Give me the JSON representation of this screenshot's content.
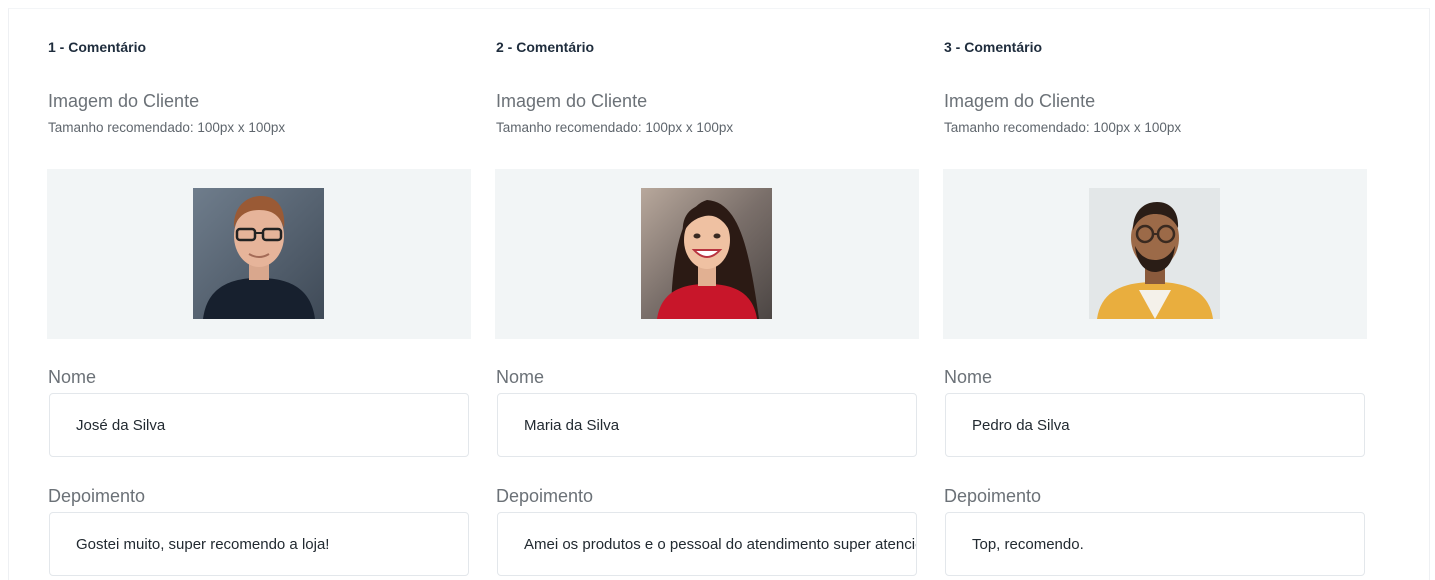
{
  "comments": [
    {
      "title": "1 - Comentário",
      "image_label": "Imagem do Cliente",
      "image_hint": "Tamanho recomendado: 100px x 100px",
      "name_label": "Nome",
      "name_value": "José da Silva",
      "testimonial_label": "Depoimento",
      "testimonial_value": "Gostei muito, super recomendo a loja!"
    },
    {
      "title": "2 - Comentário",
      "image_label": "Imagem do Cliente",
      "image_hint": "Tamanho recomendado: 100px x 100px",
      "name_label": "Nome",
      "name_value": "Maria da Silva",
      "testimonial_label": "Depoimento",
      "testimonial_value": "Amei os produtos e o pessoal do atendimento super atencioso!"
    },
    {
      "title": "3 - Comentário",
      "image_label": "Imagem do Cliente",
      "image_hint": "Tamanho recomendado: 100px x 100px",
      "name_label": "Nome",
      "name_value": "Pedro da Silva",
      "testimonial_label": "Depoimento",
      "testimonial_value": "Top, recomendo."
    }
  ],
  "colors": {
    "title": "#1f2d3d",
    "label": "#6b7177",
    "image_box_bg": "#f2f5f6",
    "input_border": "#e3e7eb"
  }
}
